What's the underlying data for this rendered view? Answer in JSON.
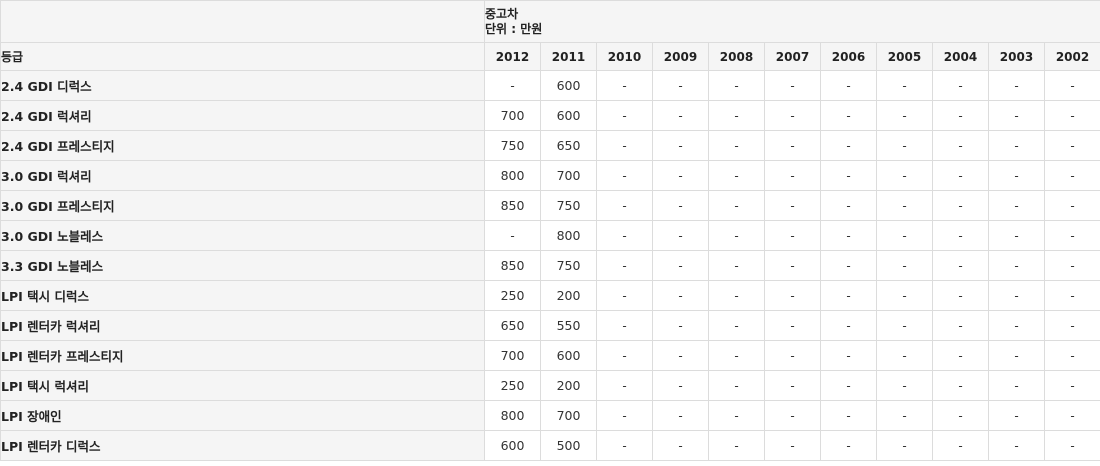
{
  "caption": {
    "line1": "중고차",
    "line2": "단위 : 만원"
  },
  "grade_header": "등급",
  "years": [
    "2012",
    "2011",
    "2010",
    "2009",
    "2008",
    "2007",
    "2006",
    "2005",
    "2004",
    "2003",
    "2002"
  ],
  "rows": [
    {
      "grade": "2.4 GDI 디럭스",
      "values": [
        "-",
        "600",
        "-",
        "-",
        "-",
        "-",
        "-",
        "-",
        "-",
        "-",
        "-"
      ]
    },
    {
      "grade": "2.4 GDI 럭셔리",
      "values": [
        "700",
        "600",
        "-",
        "-",
        "-",
        "-",
        "-",
        "-",
        "-",
        "-",
        "-"
      ]
    },
    {
      "grade": "2.4 GDI 프레스티지",
      "values": [
        "750",
        "650",
        "-",
        "-",
        "-",
        "-",
        "-",
        "-",
        "-",
        "-",
        "-"
      ]
    },
    {
      "grade": "3.0 GDI 럭셔리",
      "values": [
        "800",
        "700",
        "-",
        "-",
        "-",
        "-",
        "-",
        "-",
        "-",
        "-",
        "-"
      ]
    },
    {
      "grade": "3.0 GDI 프레스티지",
      "values": [
        "850",
        "750",
        "-",
        "-",
        "-",
        "-",
        "-",
        "-",
        "-",
        "-",
        "-"
      ]
    },
    {
      "grade": "3.0 GDI 노블레스",
      "values": [
        "-",
        "800",
        "-",
        "-",
        "-",
        "-",
        "-",
        "-",
        "-",
        "-",
        "-"
      ]
    },
    {
      "grade": "3.3 GDI 노블레스",
      "values": [
        "850",
        "750",
        "-",
        "-",
        "-",
        "-",
        "-",
        "-",
        "-",
        "-",
        "-"
      ]
    },
    {
      "grade": "LPI 택시 디럭스",
      "values": [
        "250",
        "200",
        "-",
        "-",
        "-",
        "-",
        "-",
        "-",
        "-",
        "-",
        "-"
      ]
    },
    {
      "grade": "LPI 렌터카 럭셔리",
      "values": [
        "650",
        "550",
        "-",
        "-",
        "-",
        "-",
        "-",
        "-",
        "-",
        "-",
        "-"
      ]
    },
    {
      "grade": "LPI 렌터카 프레스티지",
      "values": [
        "700",
        "600",
        "-",
        "-",
        "-",
        "-",
        "-",
        "-",
        "-",
        "-",
        "-"
      ]
    },
    {
      "grade": "LPI 택시 럭셔리",
      "values": [
        "250",
        "200",
        "-",
        "-",
        "-",
        "-",
        "-",
        "-",
        "-",
        "-",
        "-"
      ]
    },
    {
      "grade": "LPI 장애인",
      "values": [
        "800",
        "700",
        "-",
        "-",
        "-",
        "-",
        "-",
        "-",
        "-",
        "-",
        "-"
      ]
    },
    {
      "grade": "LPI 렌터카 디럭스",
      "values": [
        "600",
        "500",
        "-",
        "-",
        "-",
        "-",
        "-",
        "-",
        "-",
        "-",
        "-"
      ]
    }
  ]
}
